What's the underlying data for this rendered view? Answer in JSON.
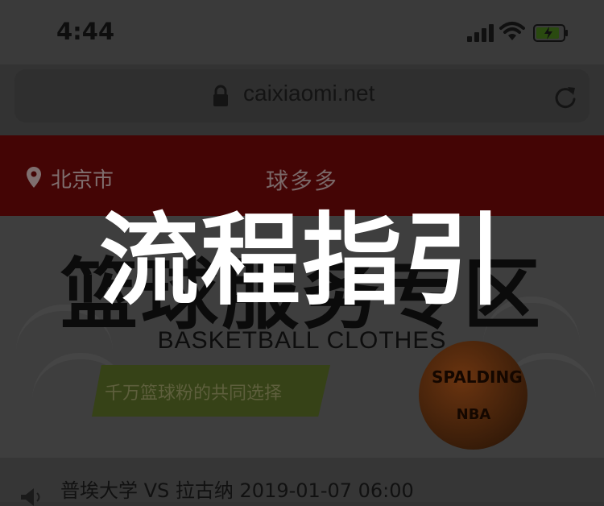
{
  "status_bar": {
    "time": "4:44"
  },
  "browser": {
    "url": "caixiaomi.net"
  },
  "header": {
    "location": "北京市",
    "title": "球多多"
  },
  "banner": {
    "title_cn": "篮球服务专区",
    "title_en": "BASKETBALL CLOTHES",
    "ribbon_text": "千万篮球粉的共同选择",
    "ball_brand": "SPALDING",
    "ball_league": "NBA"
  },
  "list": {
    "items": [
      {
        "text": "普埃大学 VS 拉古纳 2019-01-07 06:00"
      }
    ]
  },
  "overlay": {
    "title": "流程指引"
  },
  "colors": {
    "overlay": "#333333",
    "header": "#440505",
    "ribbon": "#364217",
    "text_white": "#ffffff"
  }
}
